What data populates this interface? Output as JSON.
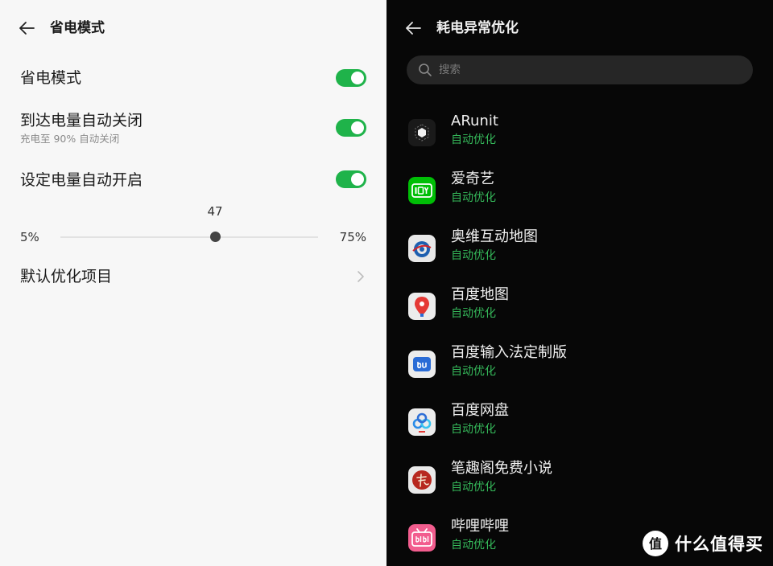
{
  "left": {
    "title": "省电模式",
    "rows": [
      {
        "label": "省电模式",
        "toggle": true
      },
      {
        "label": "到达电量自动关闭",
        "sub": "充电至 90% 自动关闭",
        "toggle": true
      },
      {
        "label": "设定电量自动开启",
        "toggle": true
      }
    ],
    "slider": {
      "value": "47",
      "min_label": "5%",
      "max_label": "75%",
      "min": 5,
      "max": 75,
      "current": 47
    },
    "default_opt": "默认优化项目"
  },
  "right": {
    "title": "耗电异常优化",
    "search_placeholder": "搜索",
    "apps": [
      {
        "name": "ARunit",
        "status": "自动优化",
        "icon": "arunit-icon"
      },
      {
        "name": "爱奇艺",
        "status": "自动优化",
        "icon": "iqiyi-icon"
      },
      {
        "name": "奥维互动地图",
        "status": "自动优化",
        "icon": "ovital-map-icon"
      },
      {
        "name": "百度地图",
        "status": "自动优化",
        "icon": "baidu-map-icon"
      },
      {
        "name": "百度输入法定制版",
        "status": "自动优化",
        "icon": "baidu-input-icon"
      },
      {
        "name": "百度网盘",
        "status": "自动优化",
        "icon": "baidu-netdisk-icon"
      },
      {
        "name": "笔趣阁免费小说",
        "status": "自动优化",
        "icon": "biquge-icon"
      },
      {
        "name": "哔哩哔哩",
        "status": "自动优化",
        "icon": "bilibili-icon"
      }
    ]
  },
  "watermark": {
    "text": "什么值得买",
    "logo_text": "值"
  },
  "colors": {
    "accent_green": "#1fb34a",
    "status_green": "#35b85a"
  }
}
